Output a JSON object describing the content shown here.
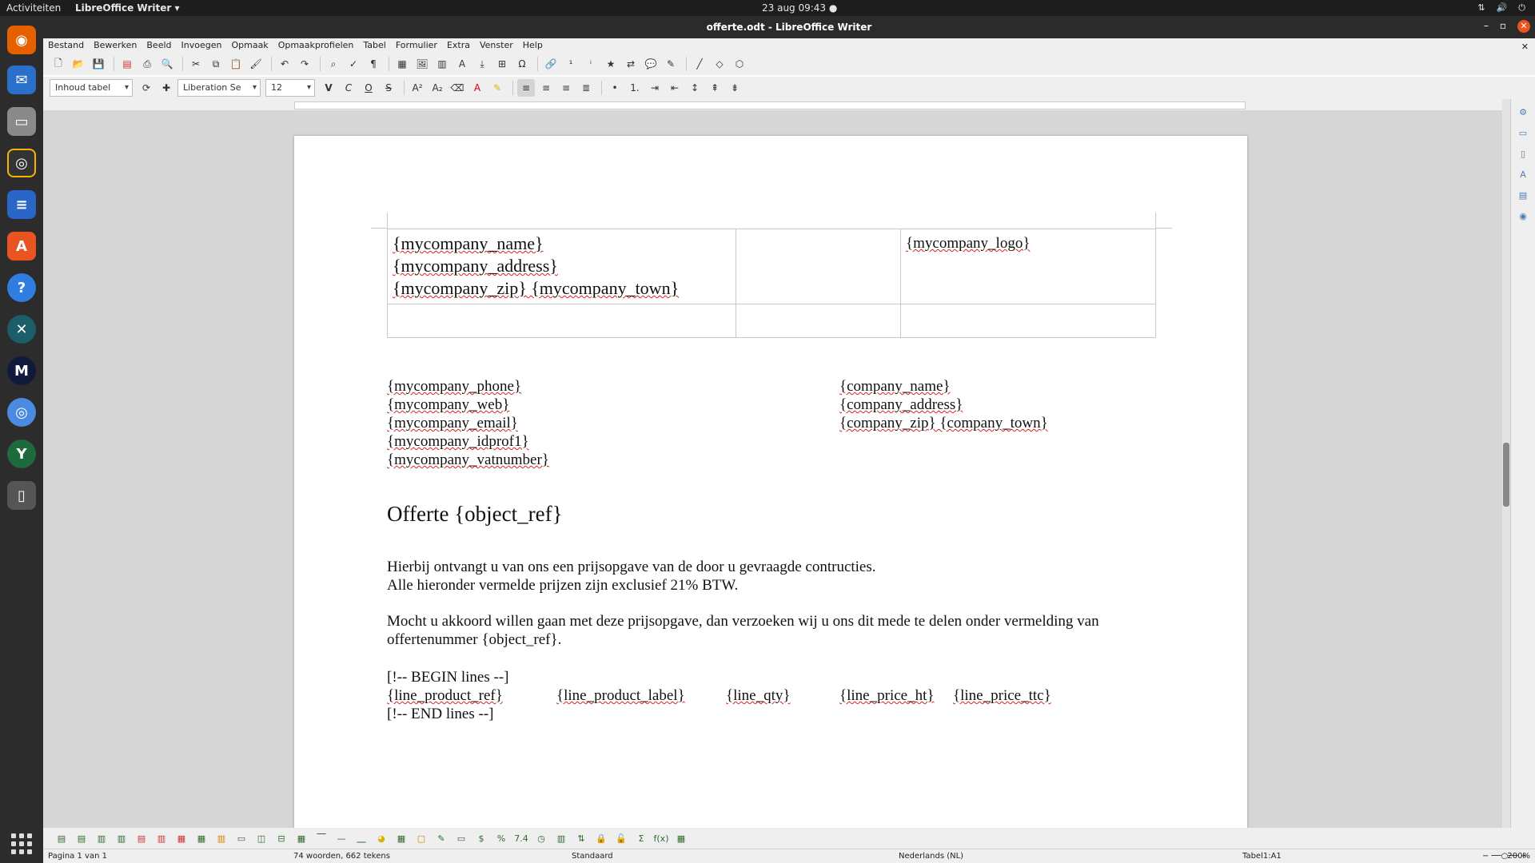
{
  "topbar": {
    "activities": "Activiteiten",
    "app_menu": "LibreOffice Writer ▾",
    "clock": "23 aug  09:43  ●"
  },
  "window": {
    "title": "offerte.odt - LibreOffice Writer"
  },
  "menu": [
    "Bestand",
    "Bewerken",
    "Beeld",
    "Invoegen",
    "Opmaak",
    "Opmaakprofielen",
    "Tabel",
    "Formulier",
    "Extra",
    "Venster",
    "Help"
  ],
  "format": {
    "style": "Inhoud tabel",
    "font": "Liberation Se",
    "size": "12",
    "bold": "V",
    "italic": "C",
    "underline": "O",
    "strike": "S"
  },
  "document": {
    "company_lines": [
      "{mycompany_name}",
      "{mycompany_address}",
      "{mycompany_zip}  {mycompany_town}"
    ],
    "logo": "{mycompany_logo}",
    "contact_lines": [
      "{mycompany_phone}",
      "{mycompany_web}",
      "{mycompany_email}",
      "{mycompany_idprof1}",
      "{mycompany_vatnumber}"
    ],
    "customer_lines": [
      "{company_name}",
      "{company_address}",
      "{company_zip}  {company_town}"
    ],
    "heading": "Offerte {object_ref}",
    "para1": [
      "Hierbij ontvangt  u van ons een prijsopgave van de door u gevraagde contructies.",
      "Alle hieronder vermelde prijzen zijn exclusief 21% BTW."
    ],
    "para2": [
      "Mocht u akkoord willen gaan met deze prijsopgave, dan verzoeken wij u ons dit mede te delen onder vermelding van",
      "offertenummer {object_ref}."
    ],
    "begin_lines": "[!-- BEGIN lines --]",
    "line_fields": [
      "{line_product_ref}",
      "{line_product_label}",
      "{line_qty}",
      "{line_price_ht}",
      "{line_price_ttc}"
    ],
    "end_lines": "[!-- END lines --]"
  },
  "status": {
    "page": "Pagina 1 van 1",
    "words": "74 woorden, 662 tekens",
    "style": "Standaard",
    "lang": "Nederlands (NL)",
    "cell": "Tabel1:A1",
    "zoom": "200%"
  }
}
